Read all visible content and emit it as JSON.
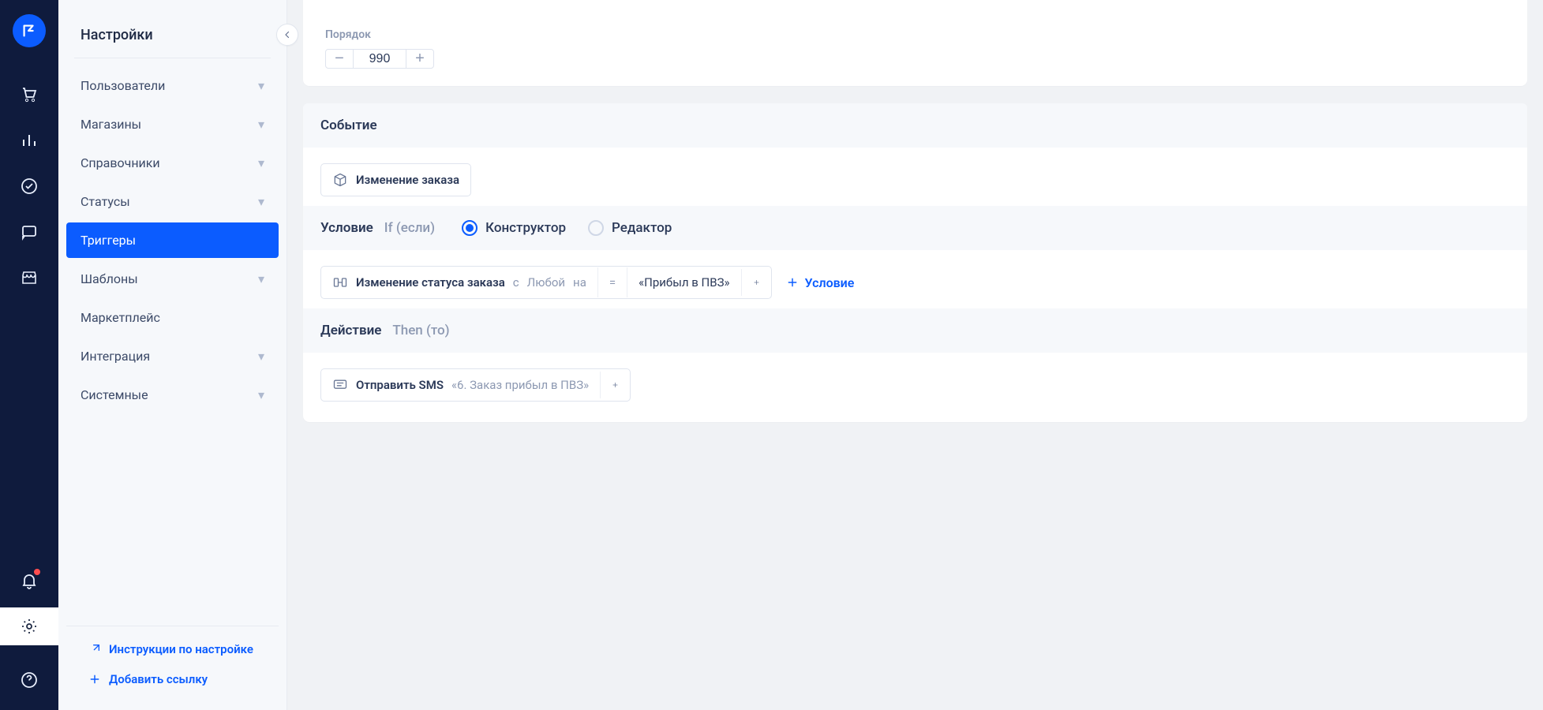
{
  "sidebar": {
    "title": "Настройки",
    "items": [
      {
        "label": "Пользователи",
        "expandable": true
      },
      {
        "label": "Магазины",
        "expandable": true
      },
      {
        "label": "Справочники",
        "expandable": true
      },
      {
        "label": "Статусы",
        "expandable": true
      },
      {
        "label": "Триггеры",
        "expandable": false,
        "active": true
      },
      {
        "label": "Шаблоны",
        "expandable": true
      },
      {
        "label": "Маркетплейс",
        "expandable": false
      },
      {
        "label": "Интеграция",
        "expandable": true
      },
      {
        "label": "Системные",
        "expandable": true
      }
    ],
    "footer": {
      "instructions": "Инструкции по настройке",
      "add_link": "Добавить ссылку"
    }
  },
  "order_field": {
    "label": "Порядок",
    "value": "990"
  },
  "event": {
    "heading": "Событие",
    "chip_label": "Изменение заказа"
  },
  "condition": {
    "heading": "Условие",
    "hint": "If (если)",
    "radio_constructor": "Конструктор",
    "radio_editor": "Редактор",
    "chip_main": "Изменение статуса заказа",
    "chip_from_word": "с",
    "chip_from": "Любой",
    "chip_to_word": "на",
    "chip_eq": "=",
    "chip_to": "«Прибыл в ПВЗ»",
    "add_condition": "Условие"
  },
  "action": {
    "heading": "Действие",
    "hint": "Then (то)",
    "chip_main": "Отправить SMS",
    "chip_value": "«6. Заказ прибыл в ПВЗ»"
  }
}
